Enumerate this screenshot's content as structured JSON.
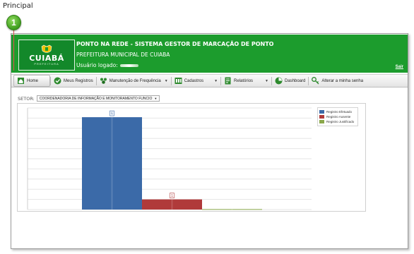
{
  "doc_label": "Principal",
  "callout_number": "1",
  "header": {
    "logo_text": "CUIABÁ",
    "logo_sub": "PREFEITURA",
    "title": "PONTO NA REDE - SISTEMA GESTOR DE MARCAÇÃO DE PONTO",
    "subtitle": "PREFEITURA MUNICIPAL DE CUIABA",
    "user_label": "Usuário logado:",
    "logout": "Sair",
    "colors": {
      "header_bg": "#1c9c2d",
      "logo_bg": "#13882a"
    }
  },
  "menu": [
    {
      "label": "Home",
      "icon": "home-icon",
      "dropdown": false,
      "active": true
    },
    {
      "label": "Meus Registros",
      "icon": "checkmark-icon",
      "dropdown": false,
      "active": false
    },
    {
      "label": "Manutenção de Frequência",
      "icon": "people-group-icon",
      "dropdown": true,
      "active": false
    },
    {
      "label": "Cadastros",
      "icon": "users-icon",
      "dropdown": true,
      "active": false
    },
    {
      "label": "Relatórios",
      "icon": "report-icon",
      "dropdown": true,
      "active": false
    },
    {
      "label": "Dashboard",
      "icon": "dashboard-icon",
      "dropdown": false,
      "active": false
    },
    {
      "label": "Alterar a minha senha",
      "icon": "key-icon",
      "dropdown": false,
      "active": false
    }
  ],
  "setor": {
    "label": "SETOR:",
    "value": "COORDENADORIA DE INFORMAÇÃO E MONITORAMENTO FUNCIO"
  },
  "chart_data": {
    "type": "bar",
    "series": [
      {
        "name": "Registro Efetuado",
        "value": 100,
        "data_label": "6",
        "color": "#3b6aa8"
      },
      {
        "name": "Registro Ausente",
        "value": 11,
        "data_label": "1",
        "color": "#b03a3a"
      },
      {
        "name": "Registro Justificado",
        "value": 0.5,
        "data_label": "",
        "color": "#8aa84a"
      }
    ],
    "ylim": [
      0,
      110
    ],
    "grid": true,
    "legend_position": "top-right"
  }
}
